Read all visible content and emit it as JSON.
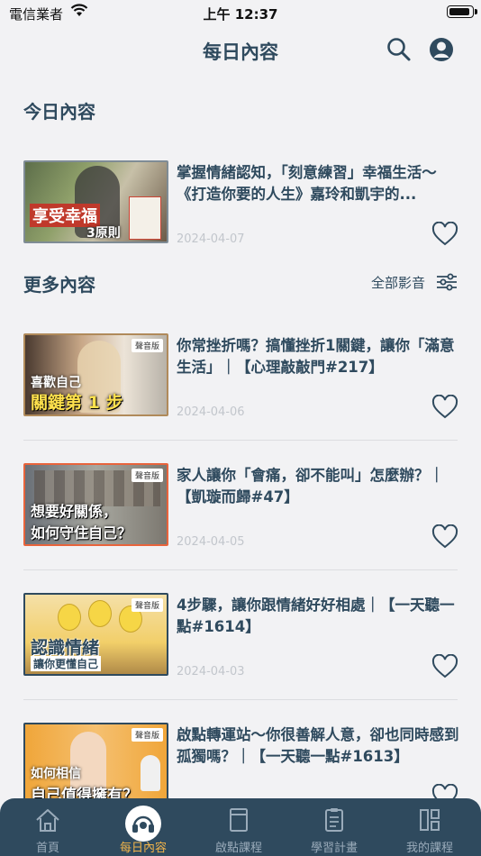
{
  "status": {
    "carrier": "電信業者",
    "time": "上午 12:37",
    "battery": 0.95
  },
  "nav": {
    "title": "每日內容"
  },
  "today": {
    "section_title": "今日內容",
    "item": {
      "title": "掌握情緒認知，「刻意練習」幸福生活～《打造你要的人生》嘉玲和凱宇的...",
      "date": "2024-04-07",
      "thumb_caption_1": "享受幸福",
      "thumb_caption_2": "3原則"
    }
  },
  "more": {
    "section_title": "更多內容",
    "filter_label": "全部影音",
    "items": [
      {
        "title": "你常挫折嗎？搞懂挫折1關鍵，讓你「滿意生活」｜【心理敲敲門#217】",
        "date": "2024-04-06",
        "thumb_caption_1": "喜歡自己",
        "thumb_caption_2": "關鍵第 1 步",
        "tag": "聲音版"
      },
      {
        "title": "家人讓你「會痛，卻不能叫」怎麼辦？｜【凱璇而歸#47】",
        "date": "2024-04-05",
        "thumb_caption_1": "想要好關係，",
        "thumb_caption_2": "如何守住自己？",
        "tag": "聲音版"
      },
      {
        "title": "4步驟，讓你跟情緒好好相處｜【一天聽一點#1614】",
        "date": "2024-04-03",
        "thumb_caption_1": "認識情緒",
        "thumb_caption_2": "讓你更懂自己",
        "tag": "聲音版"
      },
      {
        "title": "啟點轉運站～你很善解人意，卻也同時感到孤獨嗎？｜【一天聽一點#1613】",
        "date": "",
        "thumb_caption_1": "如何相信",
        "thumb_caption_2": "自己值得擁有？",
        "tag": "聲音版"
      }
    ]
  },
  "tabs": [
    {
      "label": "首頁",
      "icon": "home-icon"
    },
    {
      "label": "每日內容",
      "icon": "headphones-icon",
      "active": true
    },
    {
      "label": "啟點課程",
      "icon": "book-icon"
    },
    {
      "label": "學習計畫",
      "icon": "clipboard-icon"
    },
    {
      "label": "我的課程",
      "icon": "grid-icon"
    }
  ],
  "colors": {
    "primary": "#2f4a5e",
    "accent": "#f2b44a",
    "background": "#f2f2f4"
  }
}
